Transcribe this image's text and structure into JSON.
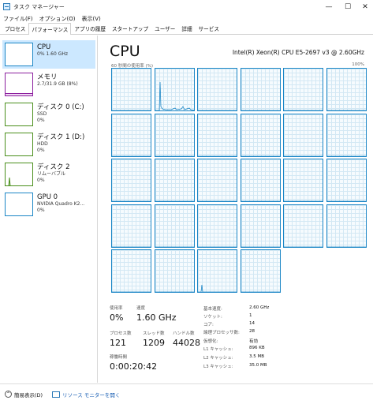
{
  "window": {
    "title": "タスク マネージャー",
    "minimize_glyph": "—",
    "maximize_glyph": "☐",
    "close_glyph": "✕"
  },
  "menu": [
    "ファイル(F)",
    "オプション(O)",
    "表示(V)"
  ],
  "tabs": [
    {
      "label": "プロセス",
      "active": false
    },
    {
      "label": "パフォーマンス",
      "active": true
    },
    {
      "label": "アプリの履歴",
      "active": false
    },
    {
      "label": "スタートアップ",
      "active": false
    },
    {
      "label": "ユーザー",
      "active": false
    },
    {
      "label": "詳細",
      "active": false
    },
    {
      "label": "サービス",
      "active": false
    }
  ],
  "sidebar": {
    "items": [
      {
        "title": "CPU",
        "sub1": "0% 1.60 GHz",
        "sub2": "",
        "color": "#1b86c6",
        "selected": true
      },
      {
        "title": "メモリ",
        "sub1": "2.7/31.9 GB (8%)",
        "sub2": "",
        "color": "#8b1f9e",
        "selected": false
      },
      {
        "title": "ディスク 0 (C:)",
        "sub1": "SSD",
        "sub2": "0%",
        "color": "#4a8f1c",
        "selected": false
      },
      {
        "title": "ディスク 1 (D:)",
        "sub1": "HDD",
        "sub2": "0%",
        "color": "#4a8f1c",
        "selected": false
      },
      {
        "title": "ディスク 2",
        "sub1": "リムーバブル",
        "sub2": "0%",
        "color": "#4a8f1c",
        "selected": false
      },
      {
        "title": "GPU 0",
        "sub1": "NVIDIA Quadro K2...",
        "sub2": "0%",
        "color": "#1b86c6",
        "selected": false
      }
    ]
  },
  "main": {
    "title": "CPU",
    "cpu_model": "Intel(R) Xeon(R) CPU E5-2697 v3 @ 2.60GHz",
    "graph_label": "60 秒間の使用率 (%)",
    "graph_max": "100%",
    "core_count": 28,
    "accent_color": "#1b86c6"
  },
  "stats": {
    "usage_label": "使用率",
    "usage_value": "0%",
    "speed_label": "速度",
    "speed_value": "1.60 GHz",
    "processes_label": "プロセス数",
    "processes_value": "121",
    "threads_label": "スレッド数",
    "threads_value": "1209",
    "handles_label": "ハンドル数",
    "handles_value": "44028",
    "uptime_label": "稼働時間",
    "uptime_value": "0:00:20:42"
  },
  "details": [
    {
      "label": "基本速度:",
      "value": "2.60 GHz"
    },
    {
      "label": "ソケット:",
      "value": "1"
    },
    {
      "label": "コア:",
      "value": "14"
    },
    {
      "label": "論理プロセッサ数:",
      "value": "28"
    },
    {
      "label": "仮想化:",
      "value": "有効"
    },
    {
      "label": "L1 キャッシュ:",
      "value": "896 KB"
    },
    {
      "label": "L2 キャッシュ:",
      "value": "3.5 MB"
    },
    {
      "label": "L3 キャッシュ:",
      "value": "35.0 MB"
    }
  ],
  "footer": {
    "fewer_details": "簡易表示(D)",
    "resource_monitor": "リソース モニターを開く"
  }
}
